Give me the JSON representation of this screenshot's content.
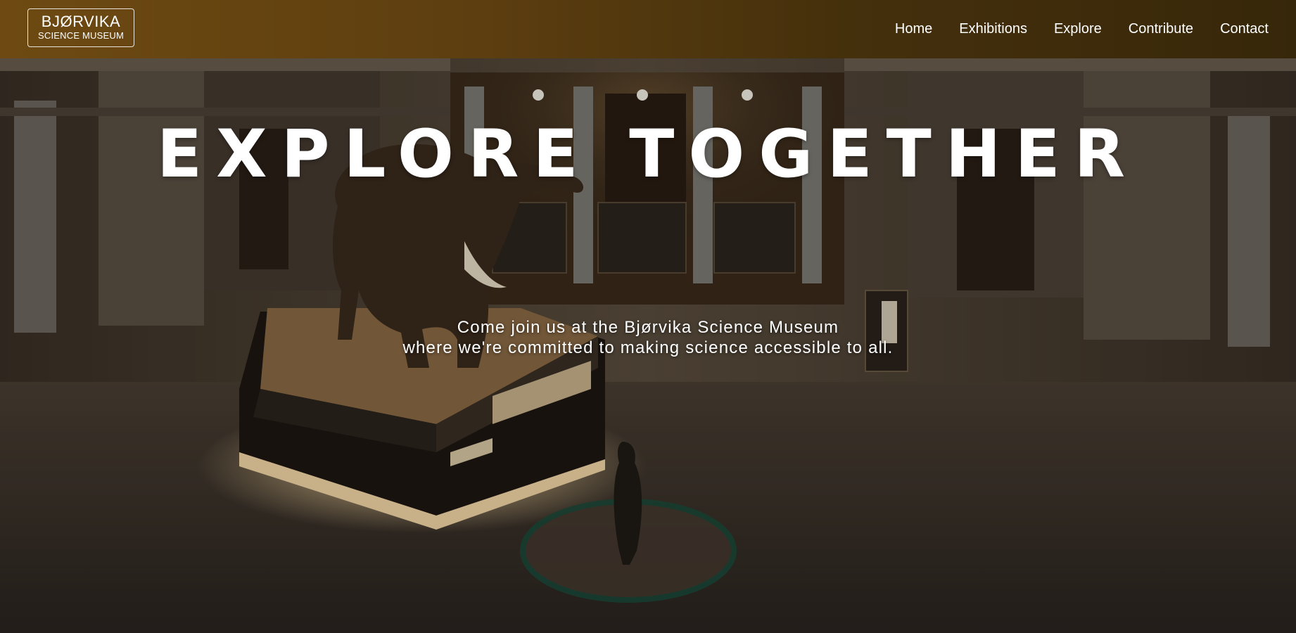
{
  "brand": {
    "name": "BJØRVIKA",
    "subtitle": "SCIENCE MUSEUM"
  },
  "nav": {
    "items": [
      {
        "label": "Home"
      },
      {
        "label": "Exhibitions"
      },
      {
        "label": "Explore"
      },
      {
        "label": "Contribute"
      },
      {
        "label": "Contact"
      }
    ]
  },
  "hero": {
    "title": "EXPLORE TOGETHER",
    "subtitle_line1": "Come join us at the Bjørvika Science Museum",
    "subtitle_line2": "where we're committed to making science accessible to all."
  },
  "colors": {
    "header_start": "#6e4a12",
    "header_end": "#37270a",
    "text": "#ffffff"
  }
}
